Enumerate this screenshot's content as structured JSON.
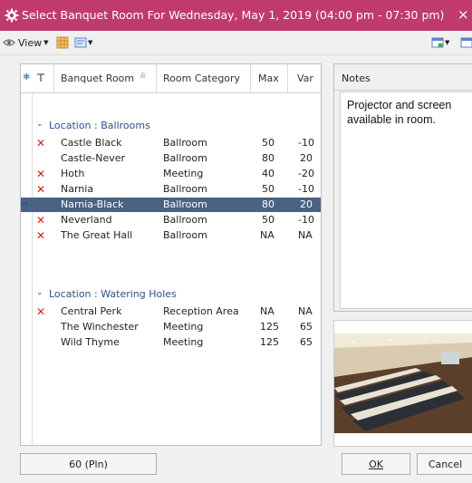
{
  "window": {
    "title": "Select Banquet Room For Wednesday, May 1, 2019 (04:00 pm - 07:30 pm)",
    "close_glyph": "×",
    "accent": "#c03a6e"
  },
  "toolbar": {
    "view_label": "View"
  },
  "grid": {
    "columns": [
      "Banquet Room",
      "Room Category",
      "Max",
      "Var"
    ],
    "groups": [
      {
        "label": "Location : Ballrooms",
        "rows": [
          {
            "name": "Castle Black",
            "category": "Ballroom",
            "max": "50",
            "var": "-10",
            "x": true
          },
          {
            "name": "Castle-Never",
            "category": "Ballroom",
            "max": "80",
            "var": "20",
            "x": false
          },
          {
            "name": "Hoth",
            "category": "Meeting",
            "max": "40",
            "var": "-20",
            "x": true
          },
          {
            "name": "Narnia",
            "category": "Ballroom",
            "max": "50",
            "var": "-10",
            "x": true
          },
          {
            "name": "Narnia-Black",
            "category": "Ballroom",
            "max": "80",
            "var": "20",
            "x": false,
            "selected": true
          },
          {
            "name": "Neverland",
            "category": "Ballroom",
            "max": "50",
            "var": "-10",
            "x": true
          },
          {
            "name": "The Great Hall",
            "category": "Ballroom",
            "max": "NA",
            "var": "NA",
            "x": true
          }
        ]
      },
      {
        "label": "Location : Watering Holes",
        "rows": [
          {
            "name": "Central Perk",
            "category": "Reception Area",
            "max": "NA",
            "var": "NA",
            "x": true
          },
          {
            "name": "The Winchester",
            "category": "Meeting",
            "max": "125",
            "var": "65",
            "x": false
          },
          {
            "name": "Wild Thyme",
            "category": "Meeting",
            "max": "125",
            "var": "65",
            "x": false
          }
        ]
      }
    ],
    "selected_color": "#4a6283"
  },
  "notes": {
    "header": "Notes",
    "text": "Projector and screen available in room."
  },
  "footer": {
    "count_label": "60 (Pln)",
    "ok_label": "OK",
    "cancel_label": "Cancel"
  }
}
